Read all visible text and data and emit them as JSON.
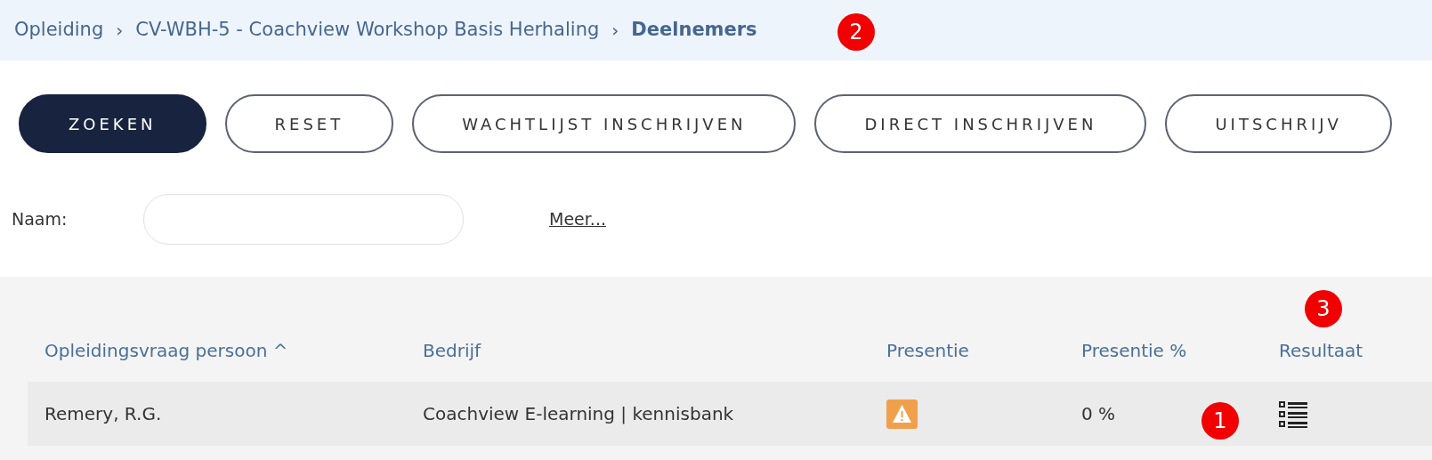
{
  "breadcrumb": [
    {
      "label": "Opleiding",
      "current": false
    },
    {
      "label": "CV-WBH-5 - Coachview Workshop Basis Herhaling",
      "current": false
    },
    {
      "label": "Deelnemers",
      "current": true
    }
  ],
  "separator": "›",
  "buttons": [
    {
      "label": "ZOEKEN",
      "primary": true
    },
    {
      "label": "RESET",
      "primary": false
    },
    {
      "label": "WACHTLIJST INSCHRIJVEN",
      "primary": false
    },
    {
      "label": "DIRECT INSCHRIJVEN",
      "primary": false
    },
    {
      "label": "UITSCHRIJV",
      "primary": false
    }
  ],
  "filter": {
    "label": "Naam:",
    "more_link": "Meer..."
  },
  "table": {
    "columns": [
      {
        "label": "Opleidingsvraag persoon",
        "sorted": true
      },
      {
        "label": "Bedrijf",
        "sorted": false
      },
      {
        "label": "Presentie",
        "sorted": false
      },
      {
        "label": "Presentie %",
        "sorted": false
      },
      {
        "label": "Resultaat",
        "sorted": false
      }
    ],
    "sort_indicator": "^",
    "rows": [
      {
        "person": "Remery, R.G.",
        "company": "Coachview E-learning | kennisbank",
        "presence_warning": true,
        "presence_pct": "0 %"
      }
    ]
  },
  "callouts": [
    "2",
    "3",
    "1"
  ]
}
